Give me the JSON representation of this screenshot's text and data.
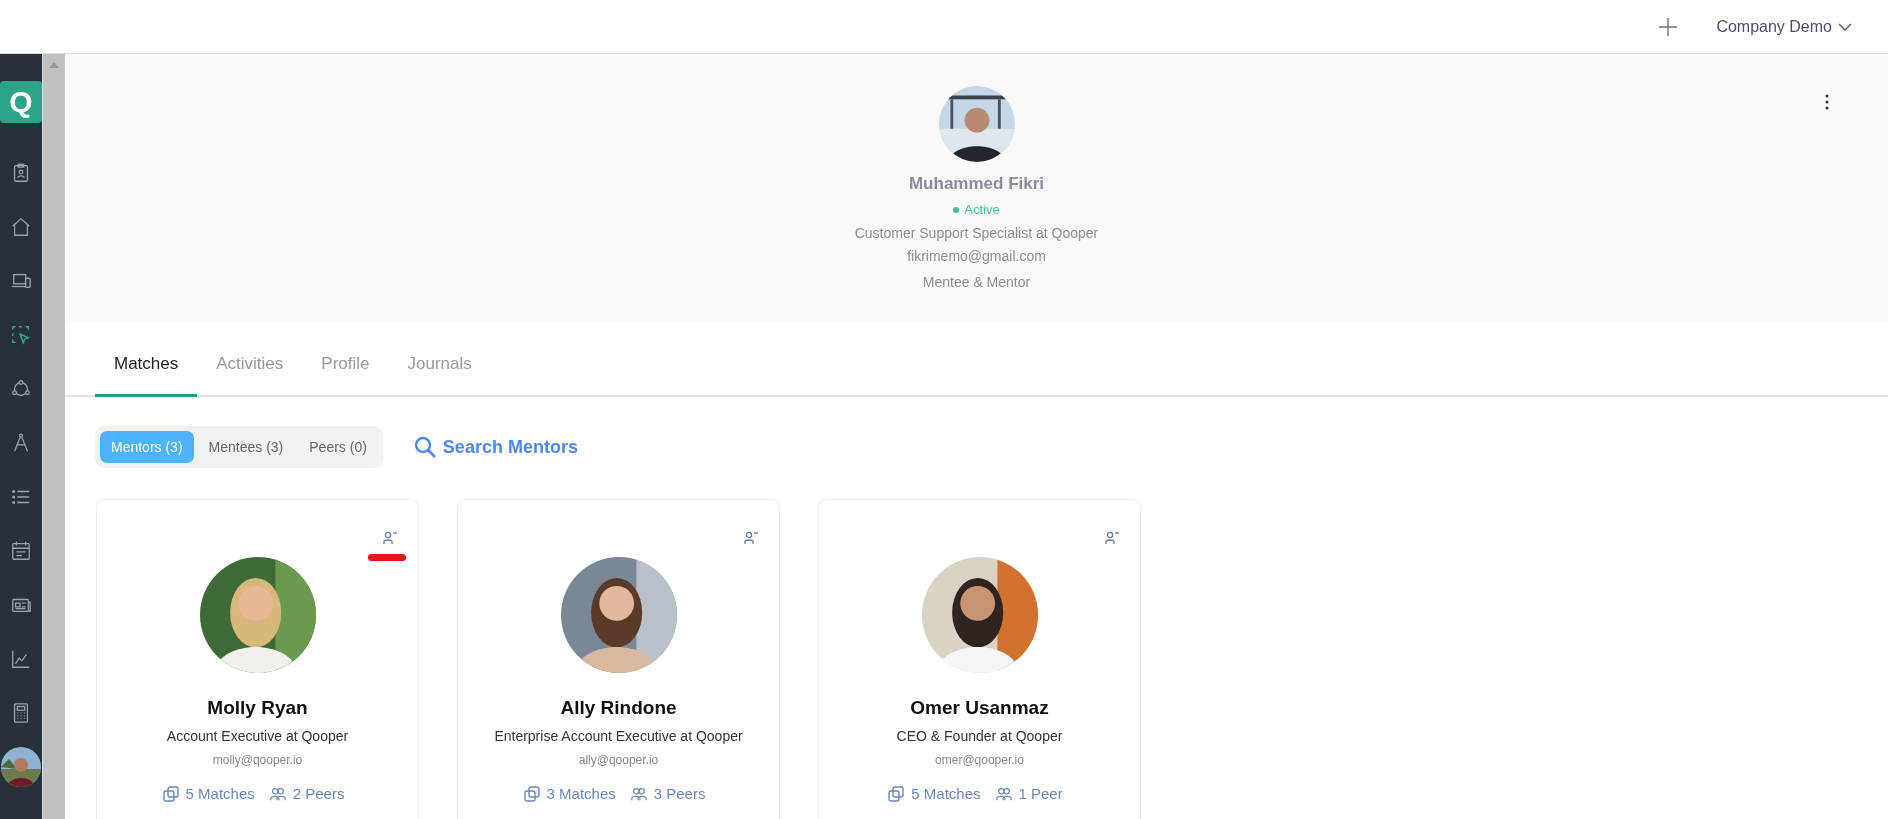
{
  "top_bar": {
    "company": "Company Demo"
  },
  "sidebar": {
    "logo": "Q",
    "items": [
      {
        "selected": false
      },
      {
        "selected": false
      },
      {
        "selected": false
      },
      {
        "selected": true
      },
      {
        "selected": false
      },
      {
        "selected": false
      },
      {
        "selected": false
      },
      {
        "selected": false
      },
      {
        "selected": false
      },
      {
        "selected": false
      },
      {
        "selected": false
      }
    ]
  },
  "profile": {
    "name": "Muhammed Fikri",
    "status": "Active",
    "role": "Customer Support Specialist at Qooper",
    "email": "fikrimemo@gmail.com",
    "type": "Mentee & Mentor"
  },
  "tabs": [
    {
      "label": "Matches",
      "selected": true
    },
    {
      "label": "Activities",
      "selected": false
    },
    {
      "label": "Profile",
      "selected": false
    },
    {
      "label": "Journals",
      "selected": false
    }
  ],
  "segments": [
    {
      "label": "Mentors (3)",
      "selected": true
    },
    {
      "label": "Mentees (3)",
      "selected": false
    },
    {
      "label": "Peers (0)",
      "selected": false
    }
  ],
  "search_link": "Search Mentors",
  "cards": [
    {
      "name": "Molly Ryan",
      "role": "Account Executive at Qooper",
      "email": "molly@qooper.io",
      "matches": "5 Matches",
      "peers": "2 Peers",
      "highlighted": true
    },
    {
      "name": "Ally Rindone",
      "role": "Enterprise Account Executive at Qooper",
      "email": "ally@qooper.io",
      "matches": "3 Matches",
      "peers": "3 Peers",
      "highlighted": false
    },
    {
      "name": "Omer Usanmaz",
      "role": "CEO & Founder at Qooper",
      "email": "omer@qooper.io",
      "matches": "5 Matches",
      "peers": "1 Peer",
      "highlighted": false
    }
  ]
}
